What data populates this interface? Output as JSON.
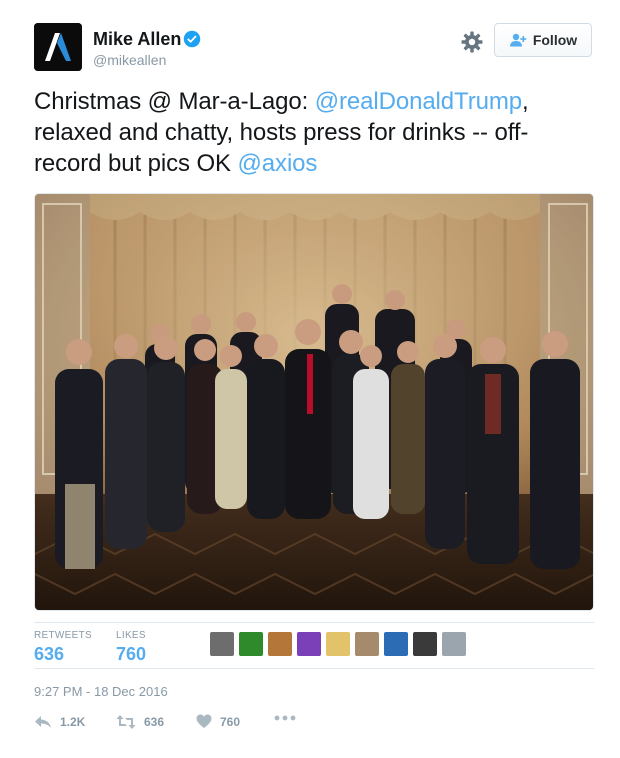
{
  "author": {
    "name": "Mike Allen",
    "handle": "@mikeallen",
    "verified": true
  },
  "follow_button": {
    "label": "Follow"
  },
  "tweet": {
    "segments": [
      {
        "text": "Christmas @ Mar-a-Lago: ",
        "type": "text"
      },
      {
        "text": "@realDonaldTrump",
        "type": "mention"
      },
      {
        "text": ", relaxed and chatty, hosts press for drinks -- off-record but pics OK ",
        "type": "text"
      },
      {
        "text": "@axios",
        "type": "mention"
      }
    ]
  },
  "stats": {
    "retweets_label": "RETWEETS",
    "retweets_value": "636",
    "likes_label": "LIKES",
    "likes_value": "760"
  },
  "likers": [
    {
      "icon": "liker-avatar-1",
      "color": "#6d6d6d"
    },
    {
      "icon": "liker-avatar-2",
      "color": "#2f8a2c"
    },
    {
      "icon": "liker-avatar-3",
      "color": "#b5763a"
    },
    {
      "icon": "liker-avatar-4",
      "color": "#7b3fb8"
    },
    {
      "icon": "liker-avatar-5",
      "color": "#e2c36a"
    },
    {
      "icon": "liker-avatar-6",
      "color": "#a58b6c"
    },
    {
      "icon": "liker-avatar-7",
      "color": "#2b6cb5"
    },
    {
      "icon": "liker-avatar-8",
      "color": "#3a3a3a"
    },
    {
      "icon": "liker-avatar-9",
      "color": "#9aa5ad"
    }
  ],
  "timestamp": "9:27 PM - 18 Dec 2016",
  "actions": {
    "reply_count": "1.2K",
    "retweet_count": "636",
    "like_count": "760"
  },
  "colors": {
    "link": "#55acee",
    "muted": "#8899a6",
    "verified": "#1da1f2"
  }
}
